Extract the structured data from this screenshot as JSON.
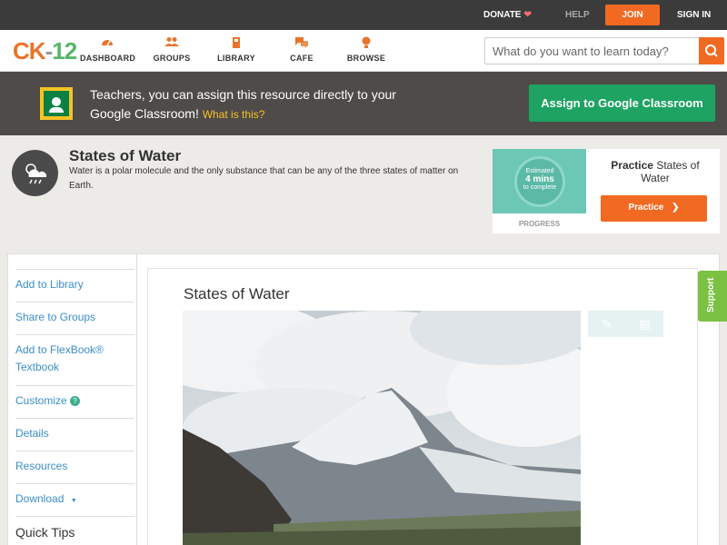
{
  "topbar": {
    "donate": "DONATE",
    "help": "HELP",
    "join": "JOIN",
    "signin": "SIGN IN"
  },
  "header": {
    "logo": {
      "ck": "CK",
      "dash": "-",
      "num": "12"
    },
    "nav": [
      {
        "label": "DASHBOARD",
        "icon": "dashboard-icon"
      },
      {
        "label": "GROUPS",
        "icon": "groups-icon"
      },
      {
        "label": "LIBRARY",
        "icon": "library-icon"
      },
      {
        "label": "CAFE",
        "icon": "cafe-icon"
      },
      {
        "label": "BROWSE",
        "icon": "browse-icon"
      }
    ],
    "search_placeholder": "What do you want to learn today?"
  },
  "banner": {
    "text": "Teachers, you can assign this resource directly to your Google Classroom!",
    "link": "What is this?",
    "button": "Assign to Google Classroom"
  },
  "concept": {
    "title": "States of Water",
    "description": "Water is a polar molecule and the only substance that can be any of the three states of matter on Earth."
  },
  "practice": {
    "estimated_line1": "Estimated",
    "estimated_mins": "4 mins",
    "estimated_line3": "to complete",
    "progress_label": "PROGRESS",
    "title_bold": "Practice",
    "title_rest": "States of Water",
    "button": "Practice"
  },
  "sidebar": {
    "items": [
      {
        "label": "Add to Library"
      },
      {
        "label": "Share to Groups"
      },
      {
        "label": "Add to FlexBook® Textbook"
      },
      {
        "label": "Customize"
      },
      {
        "label": "Details"
      },
      {
        "label": "Resources"
      },
      {
        "label": "Download"
      }
    ],
    "customize_help": "?",
    "download_arrow": "▼",
    "quick_tips": "Quick Tips"
  },
  "content": {
    "title": "States of Water"
  },
  "support": "Support",
  "colors": {
    "accent": "#f26922",
    "green": "#1ea362",
    "link": "#3a8ec8"
  }
}
